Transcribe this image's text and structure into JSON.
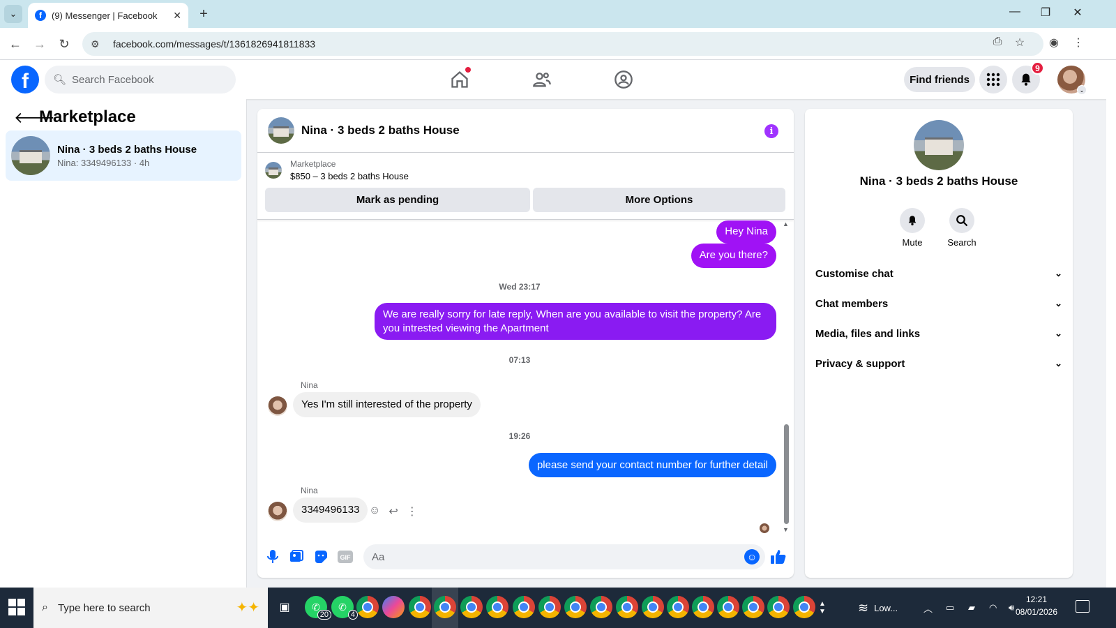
{
  "browser": {
    "tab_title": "(9) Messenger | Facebook",
    "url": "facebook.com/messages/t/1361826941811833"
  },
  "fb": {
    "search_placeholder": "Search Facebook",
    "find_friends": "Find friends",
    "notification_count": "9"
  },
  "left": {
    "title": "Marketplace",
    "conversation": {
      "name": "Nina · 3 beds 2 baths House",
      "preview": "Nina: 3349496133 · 4h"
    }
  },
  "chat": {
    "title": "Nina · 3 beds 2 baths House",
    "marketplace_label": "Marketplace",
    "listing": "$850 – 3 beds 2 baths House",
    "mark_pending": "Mark as pending",
    "more_options": "More Options",
    "messages": [
      {
        "from": "me",
        "text": "Hey Nina"
      },
      {
        "from": "me",
        "text": "Are you there?"
      },
      {
        "type": "timestamp",
        "text": "Wed 23:17"
      },
      {
        "from": "me",
        "text": "We are really sorry for late reply, When are you available to visit the property? Are you intrested viewing the Apartment"
      },
      {
        "type": "timestamp",
        "text": "07:13"
      },
      {
        "sender": "Nina",
        "from": "them",
        "text": "Yes I'm still interested of the property"
      },
      {
        "type": "timestamp",
        "text": "19:26"
      },
      {
        "from": "me",
        "text": "please send your contact number for further detail"
      },
      {
        "sender": "Nina",
        "from": "them",
        "text": "3349496133"
      }
    ],
    "composer_placeholder": "Aa"
  },
  "right": {
    "name": "Nina · 3 beds 2 baths House",
    "mute": "Mute",
    "search": "Search",
    "sections": [
      "Customise chat",
      "Chat members",
      "Media, files and links",
      "Privacy & support"
    ]
  },
  "taskbar": {
    "search_placeholder": "Type here to search",
    "whatsapp_counts": [
      "20",
      "4"
    ],
    "weather": "Low...",
    "time": "12:21",
    "date": "08/01/2026"
  },
  "colors": {
    "fb_blue": "#0866ff",
    "bubble_purple": "#a012f5",
    "bubble_violet": "#8a1bf2",
    "bubble_blue": "#0a66ff",
    "info_purple": "#a033ff"
  }
}
